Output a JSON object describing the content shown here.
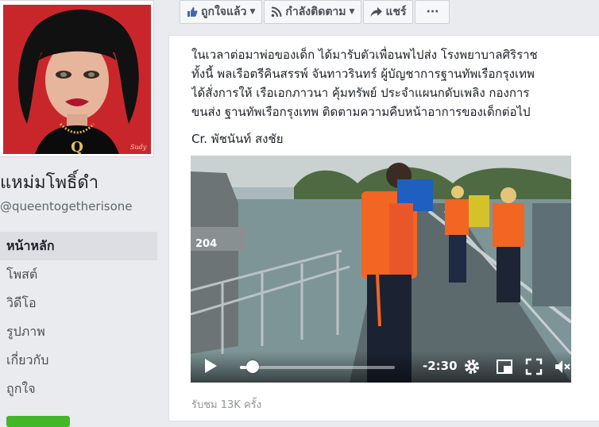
{
  "page": {
    "name": "แหม่มโพธิ์ดำ",
    "handle": "@queentogetherisone",
    "avatar_letter": "Q",
    "avatar_signature": "Sudy"
  },
  "nav": {
    "items": [
      {
        "label": "หน้าหลัก",
        "active": true
      },
      {
        "label": "โพสต์",
        "active": false
      },
      {
        "label": "วิดีโอ",
        "active": false
      },
      {
        "label": "รูปภาพ",
        "active": false
      },
      {
        "label": "เกี่ยวกับ",
        "active": false
      },
      {
        "label": "ถูกใจ",
        "active": false
      }
    ]
  },
  "actions": {
    "liked": "ถูกใจแล้ว",
    "following": "กำลังติดตาม",
    "share": "แชร์",
    "more": "···"
  },
  "post": {
    "lines": [
      "ในเวลาต่อมาพ่อของเด็ก ได้มารับตัวเพื่อนพไปส่ง โรงพยาบาลศิริราช",
      "ทั้งนี้ พลเรือตรีคินสรรพ์ จันทาวรินทร์ ผู้บัญชาการฐานทัพเรือกรุงเทพ",
      "ได้สั่งการให้ เรือเอกภาวนา คุ้มทรัพย์ ประจำแผนกดับเพลิง กองการ",
      "ขนส่ง ฐานทัพเรือกรุงเทพ ติดตามความคืบหน้าอาการของเด็กต่อไป"
    ],
    "credit": "Cr. พัชนันท์ สงชัย",
    "views": "รับชม 13K ครั้ง"
  },
  "video": {
    "time_remaining": "-2:30",
    "progress": 0.08,
    "boat_number": "204"
  },
  "colors": {
    "fb_blue": "#4267b2",
    "vest_orange": "#f26522",
    "green": "#42b72a"
  }
}
